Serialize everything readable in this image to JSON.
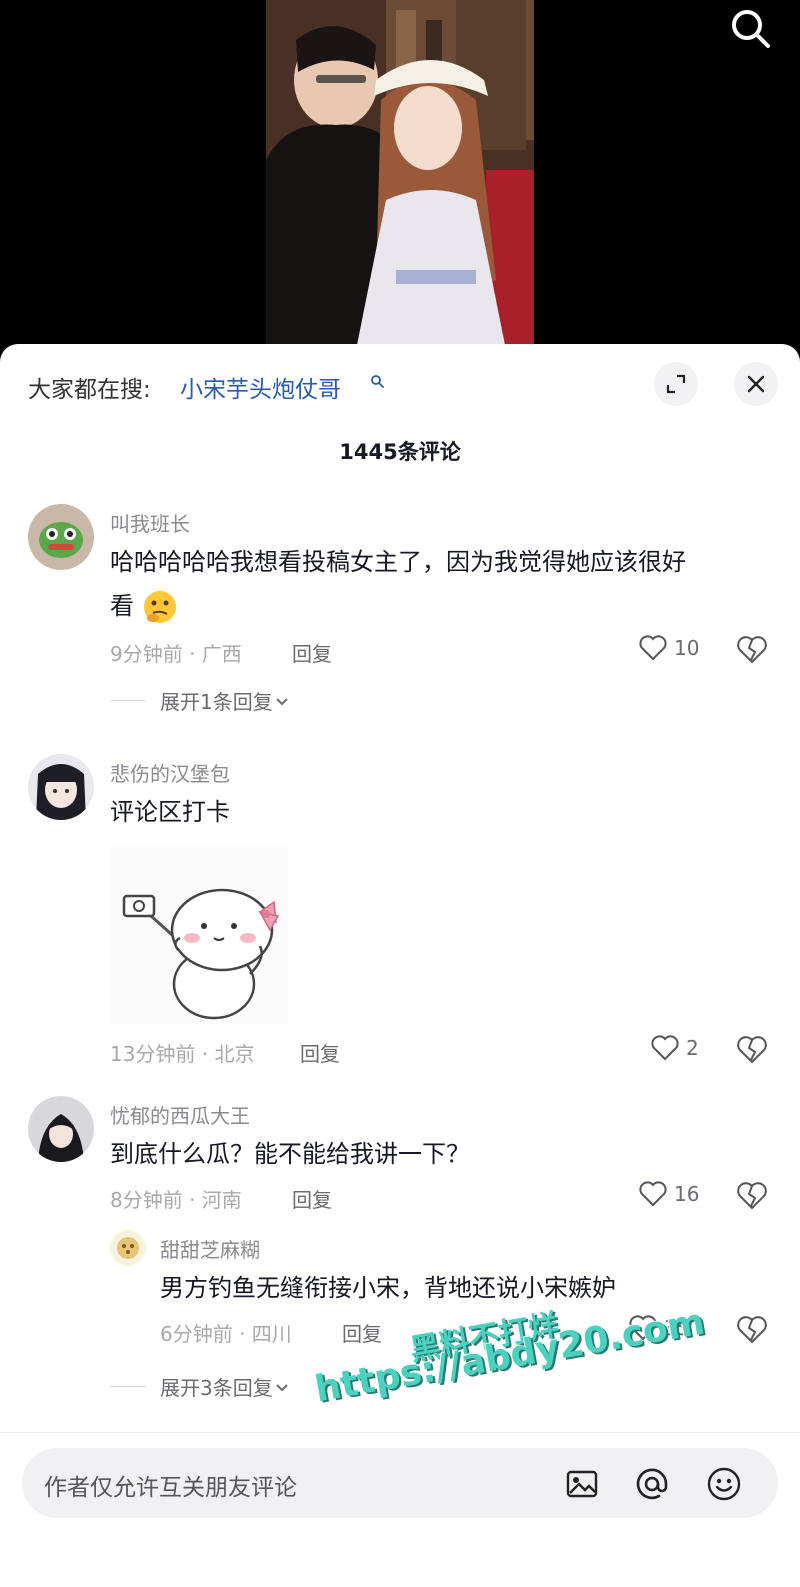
{
  "sheet": {
    "trending_label": "大家都在搜:",
    "trending_query": "小宋芋头炮仗哥",
    "comment_count": "1445条评论"
  },
  "comments": [
    {
      "user": "叫我班长",
      "text_line1": "哈哈哈哈哈我想看投稿女主了，因为我觉得她应该很好",
      "text_line2": "看",
      "emoji": "thinking-emoji",
      "meta": "9分钟前 · 广西",
      "reply": "回复",
      "likes": "10",
      "expand": "展开1条回复"
    },
    {
      "user": "悲伤的汉堡包",
      "text_line1": "评论区打卡",
      "meta": "13分钟前 · 北京",
      "reply": "回复",
      "likes": "2"
    },
    {
      "user": "忧郁的西瓜大王",
      "text_line1": "到底什么瓜？能不能给我讲一下？",
      "meta": "8分钟前 · 河南",
      "reply": "回复",
      "likes": "16",
      "sub_reply": {
        "user": "甜甜芝麻糊",
        "text": "男方钓鱼无缝衔接小宋，背地还说小宋嫉妒",
        "meta": "6分钟前 · 四川",
        "reply": "回复",
        "likes": "35"
      },
      "expand": "展开3条回复"
    }
  ],
  "watermark": {
    "line1": "黑料不打烊",
    "line2": "https://abdy20.com"
  },
  "input": {
    "placeholder": "作者仅允许互关朋友评论"
  },
  "colors": {
    "link": "#2a5ba8",
    "watermark": "#4cd1c0",
    "text_secondary": "#8a8b91"
  }
}
